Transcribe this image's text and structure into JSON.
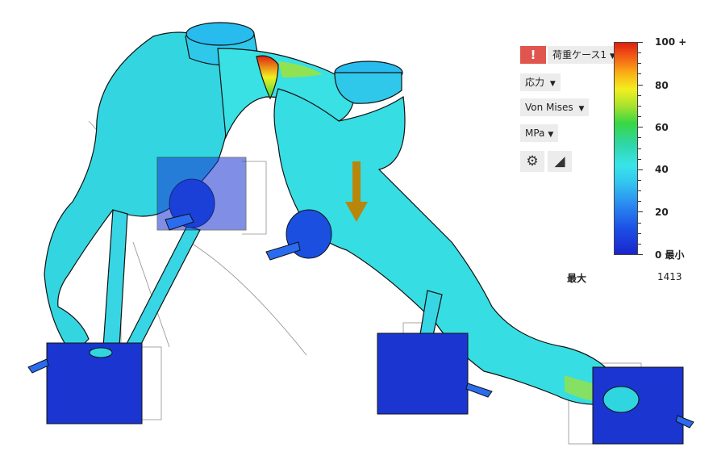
{
  "load_case": {
    "label": "荷重ケース1",
    "alert": "!"
  },
  "result_type": {
    "label": "応力"
  },
  "component": {
    "label": "Von Mises"
  },
  "unit": {
    "label": "MPa"
  },
  "tools": {
    "settings": "settings-icon",
    "probe": "probe-triangle-icon"
  },
  "legend": {
    "labels": [
      "100 +",
      "80",
      "60",
      "40",
      "20",
      "0 最小"
    ],
    "max_caption": "最大",
    "max_value": "1413"
  },
  "colors": {
    "accent_alert": "#e0554e",
    "part_stress_low": "#2fd6e0",
    "constraint_blue": "#1a3fd8",
    "load_arrow": "#b8860b"
  }
}
